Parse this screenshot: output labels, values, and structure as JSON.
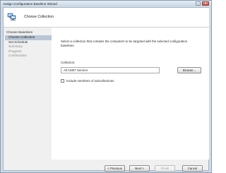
{
  "window": {
    "title": "Assign Configuration Baseline Wizard",
    "minimize": "–",
    "close": "✕"
  },
  "header": {
    "title": "Choose Collection",
    "icon": "computers-wizard-icon"
  },
  "nav": {
    "items": [
      {
        "label": "Choose Baselines",
        "state": "done"
      },
      {
        "label": "Choose Collection",
        "state": "current"
      },
      {
        "label": "Set Schedule",
        "state": "pending"
      },
      {
        "label": "Summary",
        "state": "disabled"
      },
      {
        "label": "Progress",
        "state": "disabled"
      },
      {
        "label": "Confirmation",
        "state": "disabled"
      }
    ]
  },
  "main": {
    "description": "Select a collection that contains the computers to be targeted with the selected configuration baselines.",
    "collection_label": "Collection:",
    "collection_value": "All CM07 Servers",
    "browse_label": "Browse...",
    "include_subcollections_label": "Include members of subcollections",
    "include_subcollections_checked": false
  },
  "footer": {
    "previous_label": "< Previous",
    "next_label": "Next >",
    "finish_label": "Finish",
    "cancel_label": "Cancel"
  },
  "colors": {
    "selected_nav": "#b8c6d6",
    "frame": "#cfdbe6",
    "close_button": "#c6463a"
  }
}
